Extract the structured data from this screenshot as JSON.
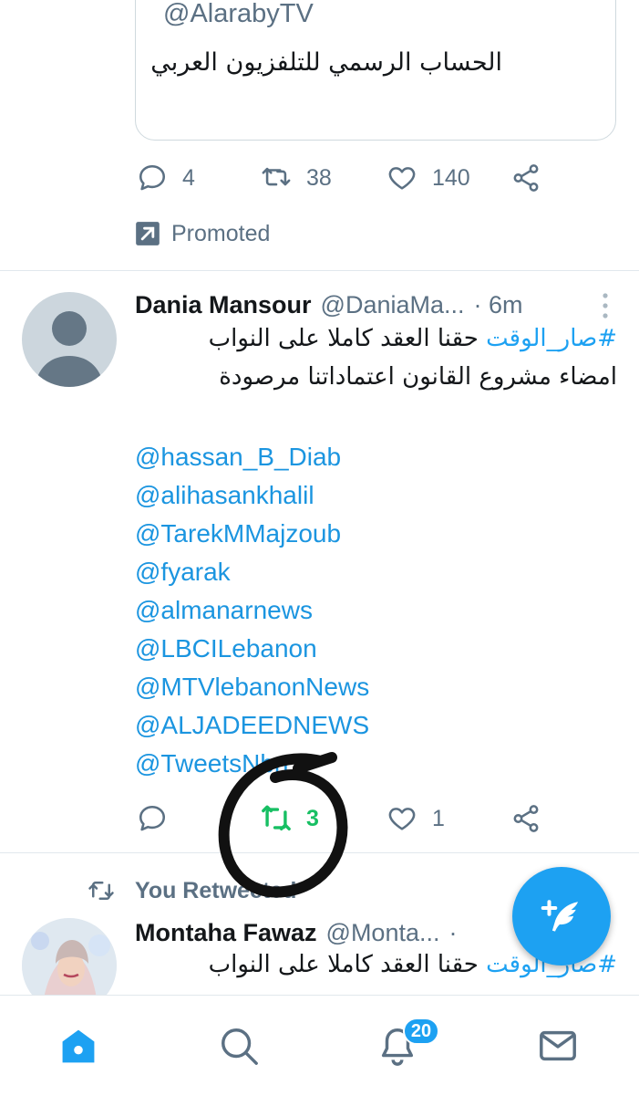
{
  "top_tweet": {
    "card": {
      "handle": "@AlarabyTV",
      "description": "الحساب الرسمي للتلفزيون العربي"
    },
    "actions": {
      "replies": "4",
      "retweets": "38",
      "likes": "140"
    },
    "promoted_label": "Promoted"
  },
  "tweet": {
    "name": "Dania Mansour",
    "handle": "@DaniaMa...",
    "time": "· 6m",
    "hashtag": "#صار_الوقت",
    "line1_rest": " حقنا العقد كاملا على النواب",
    "line2": "امضاء مشروع القانون اعتماداتنا مرصودة",
    "mentions": [
      "@hassan_B_Diab",
      "@alihasankhalil",
      "@TarekMMajzoub",
      "@fyarak",
      "@almanarnews",
      "@LBCILebanon",
      "@MTVlebanonNews",
      "@ALJADEEDNEWS",
      "@TweetsNbn"
    ],
    "actions": {
      "replies": "",
      "retweets": "3",
      "likes": "1"
    },
    "colors": {
      "retweet_active": "#17bf63"
    }
  },
  "retweeted_tweet": {
    "retweet_label": "You Retweeted",
    "name": "Montaha Fawaz",
    "handle": "@Monta...",
    "time": "·",
    "hashtag": "#صار_الوقت",
    "line1_rest": " حقنا العقد كاملا على النواب"
  },
  "fab": {
    "icon": "compose-tweet-icon",
    "color": "#1da1f2"
  },
  "bottom_nav": {
    "items": [
      "home-icon",
      "search-icon",
      "notifications-icon",
      "messages-icon"
    ],
    "notifications_badge": "20"
  },
  "colors": {
    "accent": "#1da1f2",
    "secondary_text": "#5b7083",
    "divider": "#e1e8ed"
  }
}
